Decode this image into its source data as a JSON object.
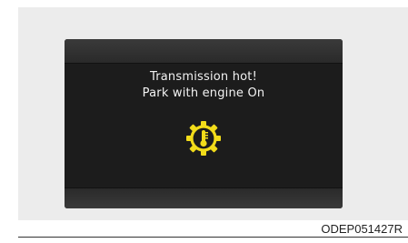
{
  "display": {
    "message_line1": "Transmission hot!",
    "message_line2": "Park with engine On",
    "warning_icon": "transmission-temperature-icon",
    "icon_color": "#f2dc1a",
    "text_color": "#f2f2f2",
    "screen_color": "#1c1c1c"
  },
  "caption": "ODEP051427R"
}
